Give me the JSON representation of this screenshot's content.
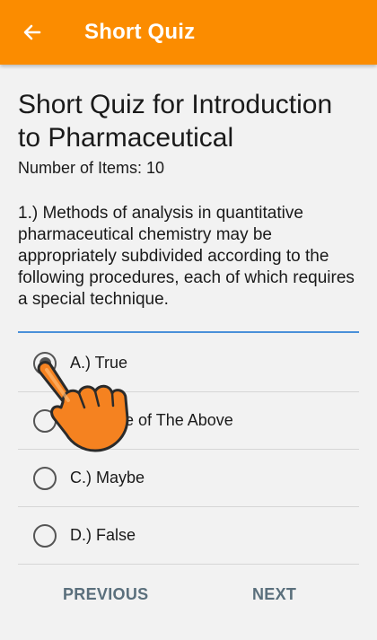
{
  "appbar": {
    "title": "Short Quiz",
    "back_icon": "arrow-left-icon",
    "background": "#fb8c00"
  },
  "quiz": {
    "title": "Short Quiz for Introduction to Pharmaceutical",
    "item_count_label": "Number of Items: 10",
    "question": "1.) Methods of analysis in quantitative pharmaceutical chemistry may be appropriately subdivided according to the following procedures, each of which requires a special technique."
  },
  "options": [
    {
      "label": "A.) True",
      "selected": true
    },
    {
      "label": "B.) None of The Above",
      "selected": false
    },
    {
      "label": "C.) Maybe",
      "selected": false
    },
    {
      "label": "D.) False",
      "selected": false
    }
  ],
  "nav": {
    "previous_label": "PREVIOUS",
    "next_label": "NEXT"
  },
  "overlay": {
    "icon": "pointing-hand-icon",
    "color": "#f58220"
  },
  "colors": {
    "accent": "#fb8c00",
    "divider": "#4a90d9",
    "nav_text": "#5a6f7c"
  }
}
